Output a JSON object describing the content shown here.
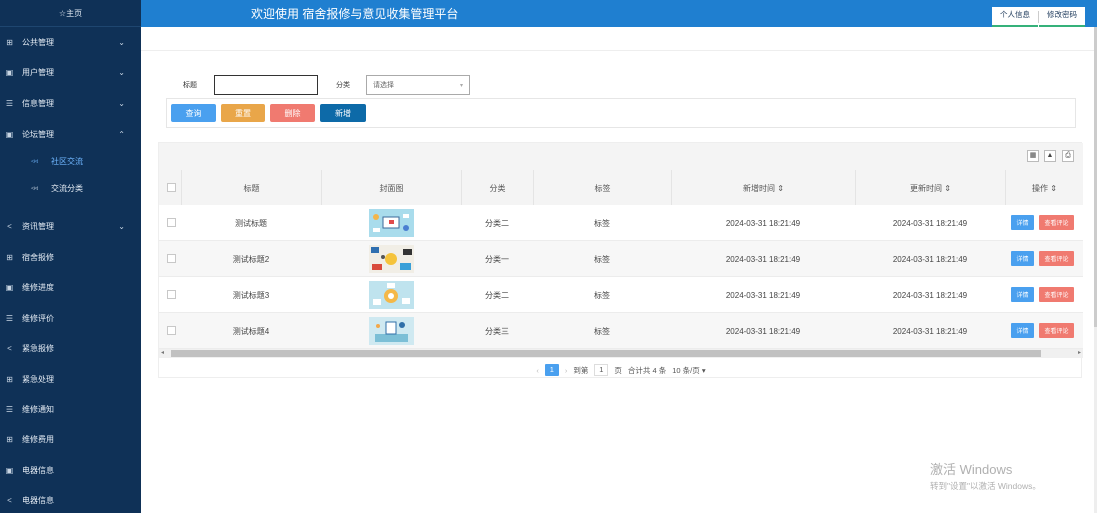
{
  "app": {
    "home": "☆主页",
    "title": "欢迎使用 宿舍报修与意见收集管理平台",
    "profile": "个人信息",
    "change_password": "修改密码"
  },
  "sidebar": {
    "items": [
      {
        "label": "公共管理",
        "icon": "grid-icon",
        "chevron": "⌄"
      },
      {
        "label": "用户管理",
        "icon": "doc-icon",
        "chevron": "⌄"
      },
      {
        "label": "信息管理",
        "icon": "list-icon",
        "chevron": "⌄"
      },
      {
        "label": "论坛管理",
        "icon": "doc-icon",
        "chevron": "⌃"
      },
      {
        "label": "资讯管理",
        "icon": "share-icon",
        "chevron": "⌄"
      },
      {
        "label": "宿舍报修",
        "icon": "grid-icon"
      },
      {
        "label": "维修进度",
        "icon": "doc-icon"
      },
      {
        "label": "维修评价",
        "icon": "list-icon"
      },
      {
        "label": "紧急报修",
        "icon": "share-icon"
      },
      {
        "label": "紧急处理",
        "icon": "grid-icon"
      },
      {
        "label": "维修通知",
        "icon": "list-icon"
      },
      {
        "label": "维修费用",
        "icon": "grid-icon"
      },
      {
        "label": "电器信息",
        "icon": "doc-icon"
      },
      {
        "label": "电器信息",
        "icon": "share-icon"
      }
    ],
    "subitems": [
      {
        "label": "社区交流",
        "active": true
      },
      {
        "label": "交流分类",
        "active": false
      }
    ]
  },
  "search": {
    "title_label": "标题",
    "title_value": "",
    "category_label": "分类",
    "category_placeholder": "请选择"
  },
  "buttons": {
    "query": "查询",
    "reset": "重置",
    "delete": "删除",
    "add": "新增"
  },
  "table": {
    "headers": {
      "title": "标题",
      "cover": "封面图",
      "category": "分类",
      "tag": "标签",
      "created": "新增时间 ⇕",
      "updated": "更新时间 ⇕",
      "ops": "操作 ⇕"
    },
    "rows": [
      {
        "title": "测试标题",
        "category": "分类二",
        "tag": "标签",
        "created": "2024-03-31 18:21:49",
        "updated": "2024-03-31 18:21:49",
        "detail": "详情",
        "comment": "查看评论"
      },
      {
        "title": "测试标题2",
        "category": "分类一",
        "tag": "标签",
        "created": "2024-03-31 18:21:49",
        "updated": "2024-03-31 18:21:49",
        "detail": "详情",
        "comment": "查看评论"
      },
      {
        "title": "测试标题3",
        "category": "分类二",
        "tag": "标签",
        "created": "2024-03-31 18:21:49",
        "updated": "2024-03-31 18:21:49",
        "detail": "详情",
        "comment": "查看评论"
      },
      {
        "title": "测试标题4",
        "category": "分类三",
        "tag": "标签",
        "created": "2024-03-31 18:21:49",
        "updated": "2024-03-31 18:21:49",
        "detail": "详情",
        "comment": "查看评论"
      }
    ]
  },
  "pager": {
    "current": "1",
    "goto_label": "到第",
    "goto_value": "1",
    "page_unit": "页",
    "total": "合计共 4 条",
    "page_size": "10 条/页 ▾"
  },
  "watermark": {
    "line1": "激活 Windows",
    "line2": "转到\"设置\"以激活 Windows。"
  },
  "colors": {
    "sidebar": "#0f3157",
    "header": "#1f7fd0",
    "query": "#4aa0ef",
    "reset": "#e9a649",
    "delete": "#f07a70",
    "add": "#0d6aa8"
  }
}
